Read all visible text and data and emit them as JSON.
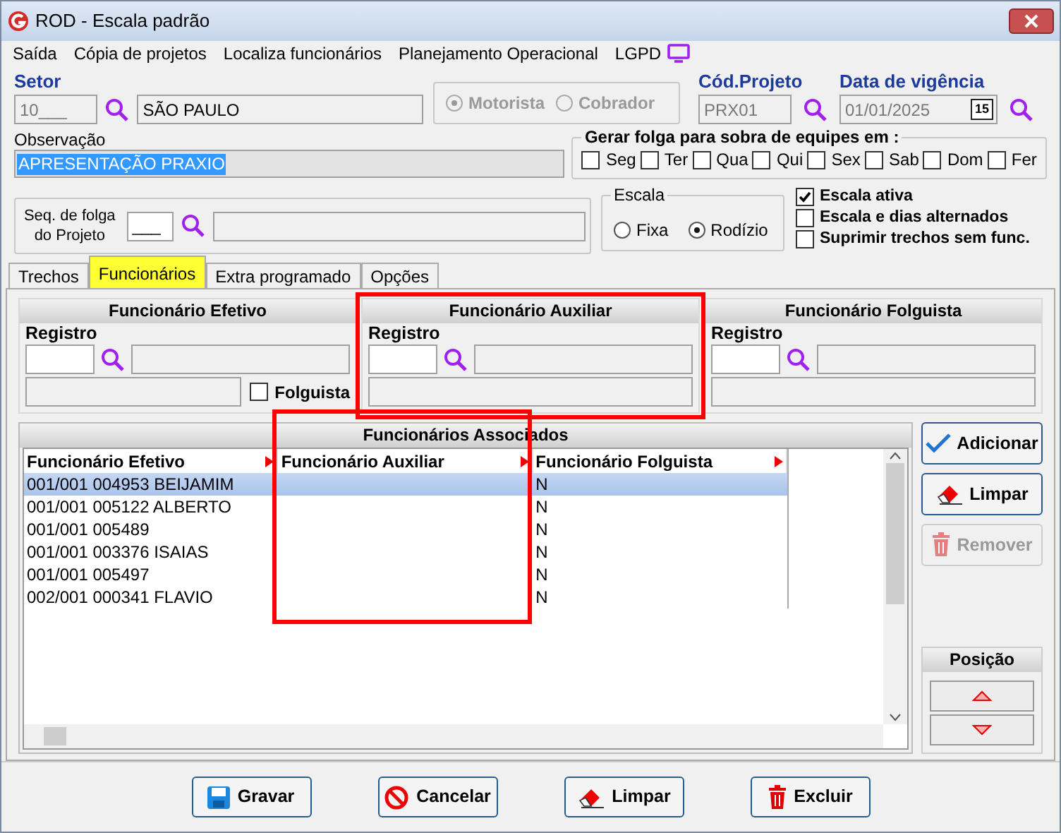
{
  "window": {
    "title": "ROD - Escala padrão"
  },
  "menu": [
    "Saída",
    "Cópia de projetos",
    "Localiza funcionários",
    "Planejamento Operacional",
    "LGPD"
  ],
  "setor": {
    "label": "Setor",
    "code": "10___",
    "name": "SÃO PAULO"
  },
  "funcao": [
    {
      "label": "Motorista",
      "selected": true
    },
    {
      "label": "Cobrador",
      "selected": false
    }
  ],
  "projeto": {
    "label": "Cód.Projeto",
    "value": "PRX01"
  },
  "vigencia": {
    "label": "Data de vigência",
    "value": "01/01/2025",
    "calendar": "15"
  },
  "observacao": {
    "label": "Observação",
    "value": "APRESENTAÇÃO PRAXIO"
  },
  "gerar_folga": {
    "title": "Gerar folga para sobra de equipes em :",
    "days": [
      {
        "label": "Seg",
        "checked": false
      },
      {
        "label": "Ter",
        "checked": false
      },
      {
        "label": "Qua",
        "checked": false
      },
      {
        "label": "Qui",
        "checked": false
      },
      {
        "label": "Sex",
        "checked": false
      },
      {
        "label": "Sab",
        "checked": false
      },
      {
        "label": "Dom",
        "checked": false
      },
      {
        "label": "Fer",
        "checked": false
      }
    ]
  },
  "seq_folga": {
    "label_1": "Seq. de folga",
    "label_2": "do Projeto",
    "value": "___"
  },
  "escala": {
    "title": "Escala",
    "options": [
      {
        "label": "Fixa",
        "selected": false
      },
      {
        "label": "Rodízio",
        "selected": true
      }
    ]
  },
  "options": [
    {
      "label": "Escala ativa",
      "checked": true
    },
    {
      "label": "Escala e dias alternados",
      "checked": false
    },
    {
      "label": "Suprimir trechos sem func.",
      "checked": false
    }
  ],
  "tabs": [
    {
      "label": "Trechos",
      "selected": false
    },
    {
      "label": "Funcionários",
      "selected": true
    },
    {
      "label": "Extra programado",
      "selected": false
    },
    {
      "label": "Opções",
      "selected": false
    }
  ],
  "panels": [
    {
      "title": "Funcionário Efetivo",
      "label": "Registro",
      "highlighted": false,
      "folguista": {
        "label": "Folguista",
        "checked": false
      }
    },
    {
      "title": "Funcionário Auxiliar",
      "label": "Registro",
      "highlighted": true
    },
    {
      "title": "Funcionário Folguista",
      "label": "Registro",
      "highlighted": false
    }
  ],
  "table": {
    "title": "Funcionários Associados",
    "columns": [
      {
        "label": "Funcionário Efetivo",
        "highlighted": false
      },
      {
        "label": "Funcionário Auxiliar",
        "highlighted": true
      },
      {
        "label": "Funcionário Folguista",
        "highlighted": false
      }
    ],
    "rows": [
      {
        "cells": [
          "001/001 004953 BEIJAMIM",
          "",
          "N"
        ],
        "selected": true
      },
      {
        "cells": [
          "001/001 005122 ALBERTO",
          "",
          "N"
        ],
        "selected": false
      },
      {
        "cells": [
          "001/001 005489",
          "",
          "N"
        ],
        "selected": false
      },
      {
        "cells": [
          "001/001 003376 ISAIAS",
          "",
          "N"
        ],
        "selected": false
      },
      {
        "cells": [
          "001/001 005497",
          "",
          "N"
        ],
        "selected": false
      },
      {
        "cells": [
          "002/001 000341 FLAVIO",
          "",
          "N"
        ],
        "selected": false
      }
    ]
  },
  "side_buttons": [
    {
      "label": "Adicionar",
      "kind": "add",
      "disabled": false
    },
    {
      "label": "Limpar",
      "kind": "eraser",
      "disabled": false
    },
    {
      "label": "Remover",
      "kind": "trash",
      "disabled": true
    }
  ],
  "posicao": {
    "title": "Posição"
  },
  "footer_buttons": [
    {
      "label": "Gravar",
      "kind": "save"
    },
    {
      "label": "Cancelar",
      "kind": "cancel"
    },
    {
      "label": "Limpar",
      "kind": "eraser"
    },
    {
      "label": "Excluir",
      "kind": "trash"
    }
  ]
}
